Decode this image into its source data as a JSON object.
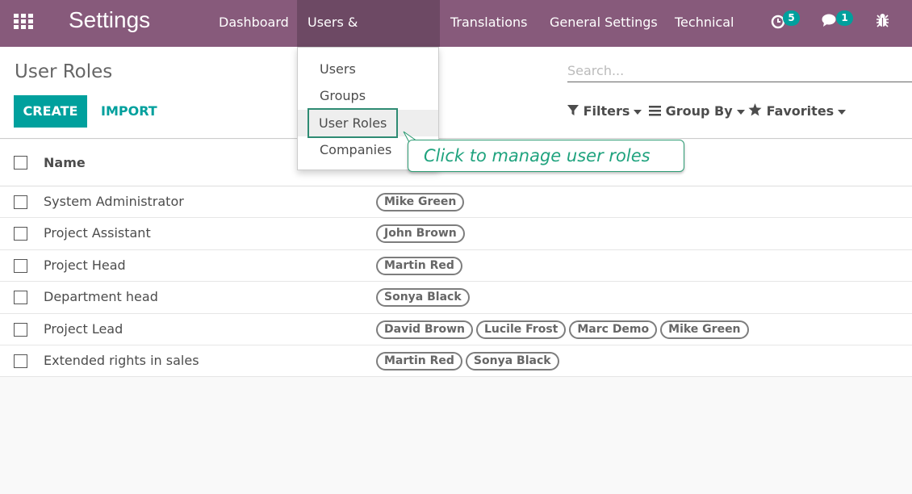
{
  "topbar": {
    "brand": "Settings",
    "menus": [
      "Dashboard",
      "Users & Companies",
      "Translations",
      "General Settings",
      "Technical"
    ],
    "activities_count": "5",
    "messages_count": "1",
    "accent_color": "#875a7b"
  },
  "control": {
    "title": "User Roles",
    "create_label": "CREATE",
    "import_label": "IMPORT",
    "search_placeholder": "Search...",
    "filters_label": "Filters",
    "groupby_label": "Group By",
    "favorites_label": "Favorites"
  },
  "list": {
    "column_name": "Name",
    "rows": [
      {
        "name": "System Administrator",
        "users": [
          "Mike Green"
        ]
      },
      {
        "name": "Project Assistant",
        "users": [
          "John Brown"
        ]
      },
      {
        "name": "Project Head",
        "users": [
          "Martin Red"
        ]
      },
      {
        "name": "Department head",
        "users": [
          "Sonya Black"
        ]
      },
      {
        "name": "Project Lead",
        "users": [
          "David Brown",
          "Lucile Frost",
          "Marc Demo",
          "Mike Green"
        ]
      },
      {
        "name": "Extended rights in sales",
        "users": [
          "Martin Red",
          "Sonya Black"
        ]
      }
    ]
  },
  "dropdown": {
    "items": [
      "Users",
      "Groups",
      "User Roles",
      "Companies"
    ]
  },
  "tooltip": {
    "text": "Click to manage user roles"
  }
}
